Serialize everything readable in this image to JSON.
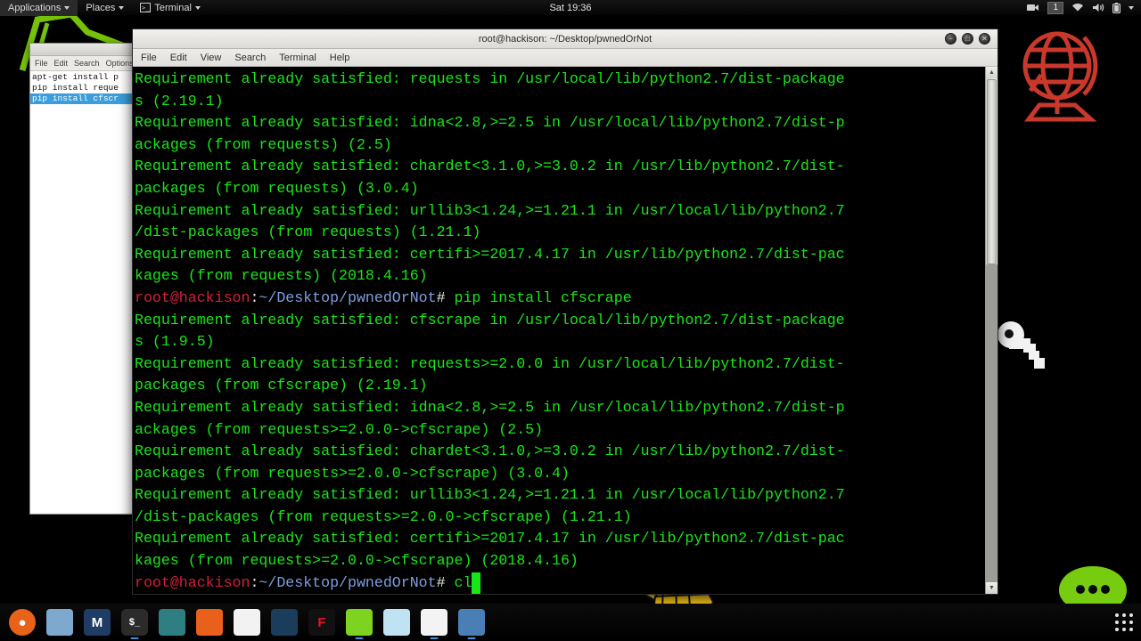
{
  "panel": {
    "applications": "Applications",
    "places": "Places",
    "terminal": "Terminal",
    "terminal_icon": "terminal-icon",
    "clock": "Sat 19:36",
    "tray": {
      "camera_icon": "video-camera-icon",
      "workspace": "1",
      "wifi_icon": "wifi-icon",
      "volume_icon": "volume-icon",
      "battery_icon": "battery-icon",
      "dropdown_icon": "chevron-down-icon"
    }
  },
  "editor": {
    "menu": [
      "File",
      "Edit",
      "Search",
      "Options"
    ],
    "lines": [
      {
        "text": "apt-get install p",
        "selected": false
      },
      {
        "text": "pip install reque",
        "selected": false
      },
      {
        "text": "pip install cfscr",
        "selected": true
      }
    ]
  },
  "terminal": {
    "title": "root@hackison: ~/Desktop/pwnedOrNot",
    "menu": [
      "File",
      "Edit",
      "View",
      "Search",
      "Terminal",
      "Help"
    ],
    "window_buttons": {
      "minimize": "−",
      "maximize": "□",
      "close": "✕"
    },
    "colors": {
      "foreground": "#19e619",
      "background": "#000000",
      "user": "#d21f3c",
      "path": "#7d9fe0",
      "punct": "#e6e6e6"
    },
    "prompt": {
      "user_host": "root@hackison",
      "colon": ":",
      "path": "~/Desktop/pwnedOrNot",
      "hash": "# "
    },
    "lines": [
      {
        "type": "out",
        "text": "Requirement already satisfied: requests in /usr/local/lib/python2.7/dist-package"
      },
      {
        "type": "out",
        "text": "s (2.19.1)"
      },
      {
        "type": "out",
        "text": "Requirement already satisfied: idna<2.8,>=2.5 in /usr/local/lib/python2.7/dist-p"
      },
      {
        "type": "out",
        "text": "ackages (from requests) (2.5)"
      },
      {
        "type": "out",
        "text": "Requirement already satisfied: chardet<3.1.0,>=3.0.2 in /usr/lib/python2.7/dist-"
      },
      {
        "type": "out",
        "text": "packages (from requests) (3.0.4)"
      },
      {
        "type": "out",
        "text": "Requirement already satisfied: urllib3<1.24,>=1.21.1 in /usr/local/lib/python2.7"
      },
      {
        "type": "out",
        "text": "/dist-packages (from requests) (1.21.1)"
      },
      {
        "type": "out",
        "text": "Requirement already satisfied: certifi>=2017.4.17 in /usr/lib/python2.7/dist-pac"
      },
      {
        "type": "out",
        "text": "kages (from requests) (2018.4.16)"
      },
      {
        "type": "prompt",
        "command": "pip install cfscrape"
      },
      {
        "type": "out",
        "text": "Requirement already satisfied: cfscrape in /usr/local/lib/python2.7/dist-package"
      },
      {
        "type": "out",
        "text": "s (1.9.5)"
      },
      {
        "type": "out",
        "text": "Requirement already satisfied: requests>=2.0.0 in /usr/local/lib/python2.7/dist-"
      },
      {
        "type": "out",
        "text": "packages (from cfscrape) (2.19.1)"
      },
      {
        "type": "out",
        "text": "Requirement already satisfied: idna<2.8,>=2.5 in /usr/local/lib/python2.7/dist-p"
      },
      {
        "type": "out",
        "text": "ackages (from requests>=2.0.0->cfscrape) (2.5)"
      },
      {
        "type": "out",
        "text": "Requirement already satisfied: chardet<3.1.0,>=3.0.2 in /usr/lib/python2.7/dist-"
      },
      {
        "type": "out",
        "text": "packages (from requests>=2.0.0->cfscrape) (3.0.4)"
      },
      {
        "type": "out",
        "text": "Requirement already satisfied: urllib3<1.24,>=1.21.1 in /usr/local/lib/python2.7"
      },
      {
        "type": "out",
        "text": "/dist-packages (from requests>=2.0.0->cfscrape) (1.21.1)"
      },
      {
        "type": "out",
        "text": "Requirement already satisfied: certifi>=2017.4.17 in /usr/lib/python2.7/dist-pac"
      },
      {
        "type": "out",
        "text": "kages (from requests>=2.0.0->cfscrape) (2018.4.16)"
      },
      {
        "type": "prompt",
        "command": "cl",
        "cursor": true
      }
    ]
  },
  "dock": {
    "items": [
      {
        "name": "dock-item-ubuntu",
        "glyph": "●",
        "bg": "#e8621a",
        "radius": "50%",
        "running": false
      },
      {
        "name": "dock-item-files",
        "glyph": "",
        "bg": "#7fa8cf",
        "radius": "4px",
        "running": false
      },
      {
        "name": "dock-item-metasploit",
        "glyph": "M",
        "bg": "#1e3c64",
        "radius": "4px",
        "running": false
      },
      {
        "name": "dock-item-terminal",
        "glyph": "$_",
        "bg": "#2b2b2b",
        "radius": "6px",
        "running": true
      },
      {
        "name": "dock-item-avatar",
        "glyph": "",
        "bg": "#2f7f82",
        "radius": "4px",
        "running": false
      },
      {
        "name": "dock-item-burpsuite",
        "glyph": "",
        "bg": "#e8601c",
        "radius": "4px",
        "running": false
      },
      {
        "name": "dock-item-palette",
        "glyph": "",
        "bg": "#f2f2f2",
        "radius": "4px",
        "running": false
      },
      {
        "name": "dock-item-wireshark",
        "glyph": "",
        "bg": "#1b3d5c",
        "radius": "4px",
        "running": false
      },
      {
        "name": "dock-item-flash",
        "glyph": "F",
        "bg": "#111111",
        "radius": "4px",
        "running": false
      },
      {
        "name": "dock-item-notepad",
        "glyph": "",
        "bg": "#7ed321",
        "radius": "4px",
        "running": true
      },
      {
        "name": "dock-item-edge",
        "glyph": "",
        "bg": "#bfe3f2",
        "radius": "4px",
        "running": false
      },
      {
        "name": "dock-item-chrome",
        "glyph": "",
        "bg": "#f3f3f3",
        "radius": "4px",
        "running": true
      },
      {
        "name": "dock-item-screenshot",
        "glyph": "",
        "bg": "#4a7fb5",
        "radius": "4px",
        "running": true
      }
    ]
  },
  "desktop": {
    "globe_icon": "red-globe-icon",
    "key_icon": "white-key-icon",
    "chat_icon": "green-chat-bubble-icon",
    "wireglobe_icon": "yellow-wireframe-globe-icon",
    "scribble_icon": "green-scribble-icon",
    "dots_icon": "app-grid-dots-icon"
  }
}
